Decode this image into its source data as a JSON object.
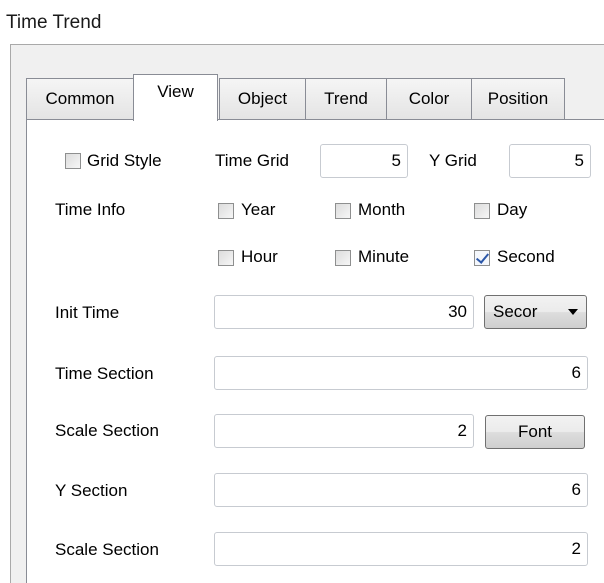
{
  "window": {
    "title": "Time Trend"
  },
  "tabs": [
    {
      "label": "Common"
    },
    {
      "label": "View"
    },
    {
      "label": "Object"
    },
    {
      "label": "Trend"
    },
    {
      "label": "Color"
    },
    {
      "label": "Position"
    }
  ],
  "active_tab": "View",
  "view": {
    "grid_style": {
      "label": "Grid Style",
      "checked": false
    },
    "time_grid": {
      "label": "Time Grid",
      "value": "5"
    },
    "y_grid": {
      "label": "Y Grid",
      "value": "5"
    },
    "time_info": {
      "label": "Time Info",
      "year": {
        "label": "Year",
        "checked": false
      },
      "month": {
        "label": "Month",
        "checked": false
      },
      "day": {
        "label": "Day",
        "checked": false
      },
      "hour": {
        "label": "Hour",
        "checked": false
      },
      "minute": {
        "label": "Minute",
        "checked": false
      },
      "second": {
        "label": "Second",
        "checked": true
      }
    },
    "init_time": {
      "label": "Init Time",
      "value": "30",
      "unit": "Secor"
    },
    "time_section": {
      "label": "Time Section",
      "value": "6"
    },
    "scale_section_1": {
      "label": "Scale Section",
      "value": "2"
    },
    "font_button": {
      "label": "Font"
    },
    "y_section": {
      "label": "Y Section",
      "value": "6"
    },
    "scale_section_2": {
      "label": "Scale Section",
      "value": "2"
    }
  }
}
